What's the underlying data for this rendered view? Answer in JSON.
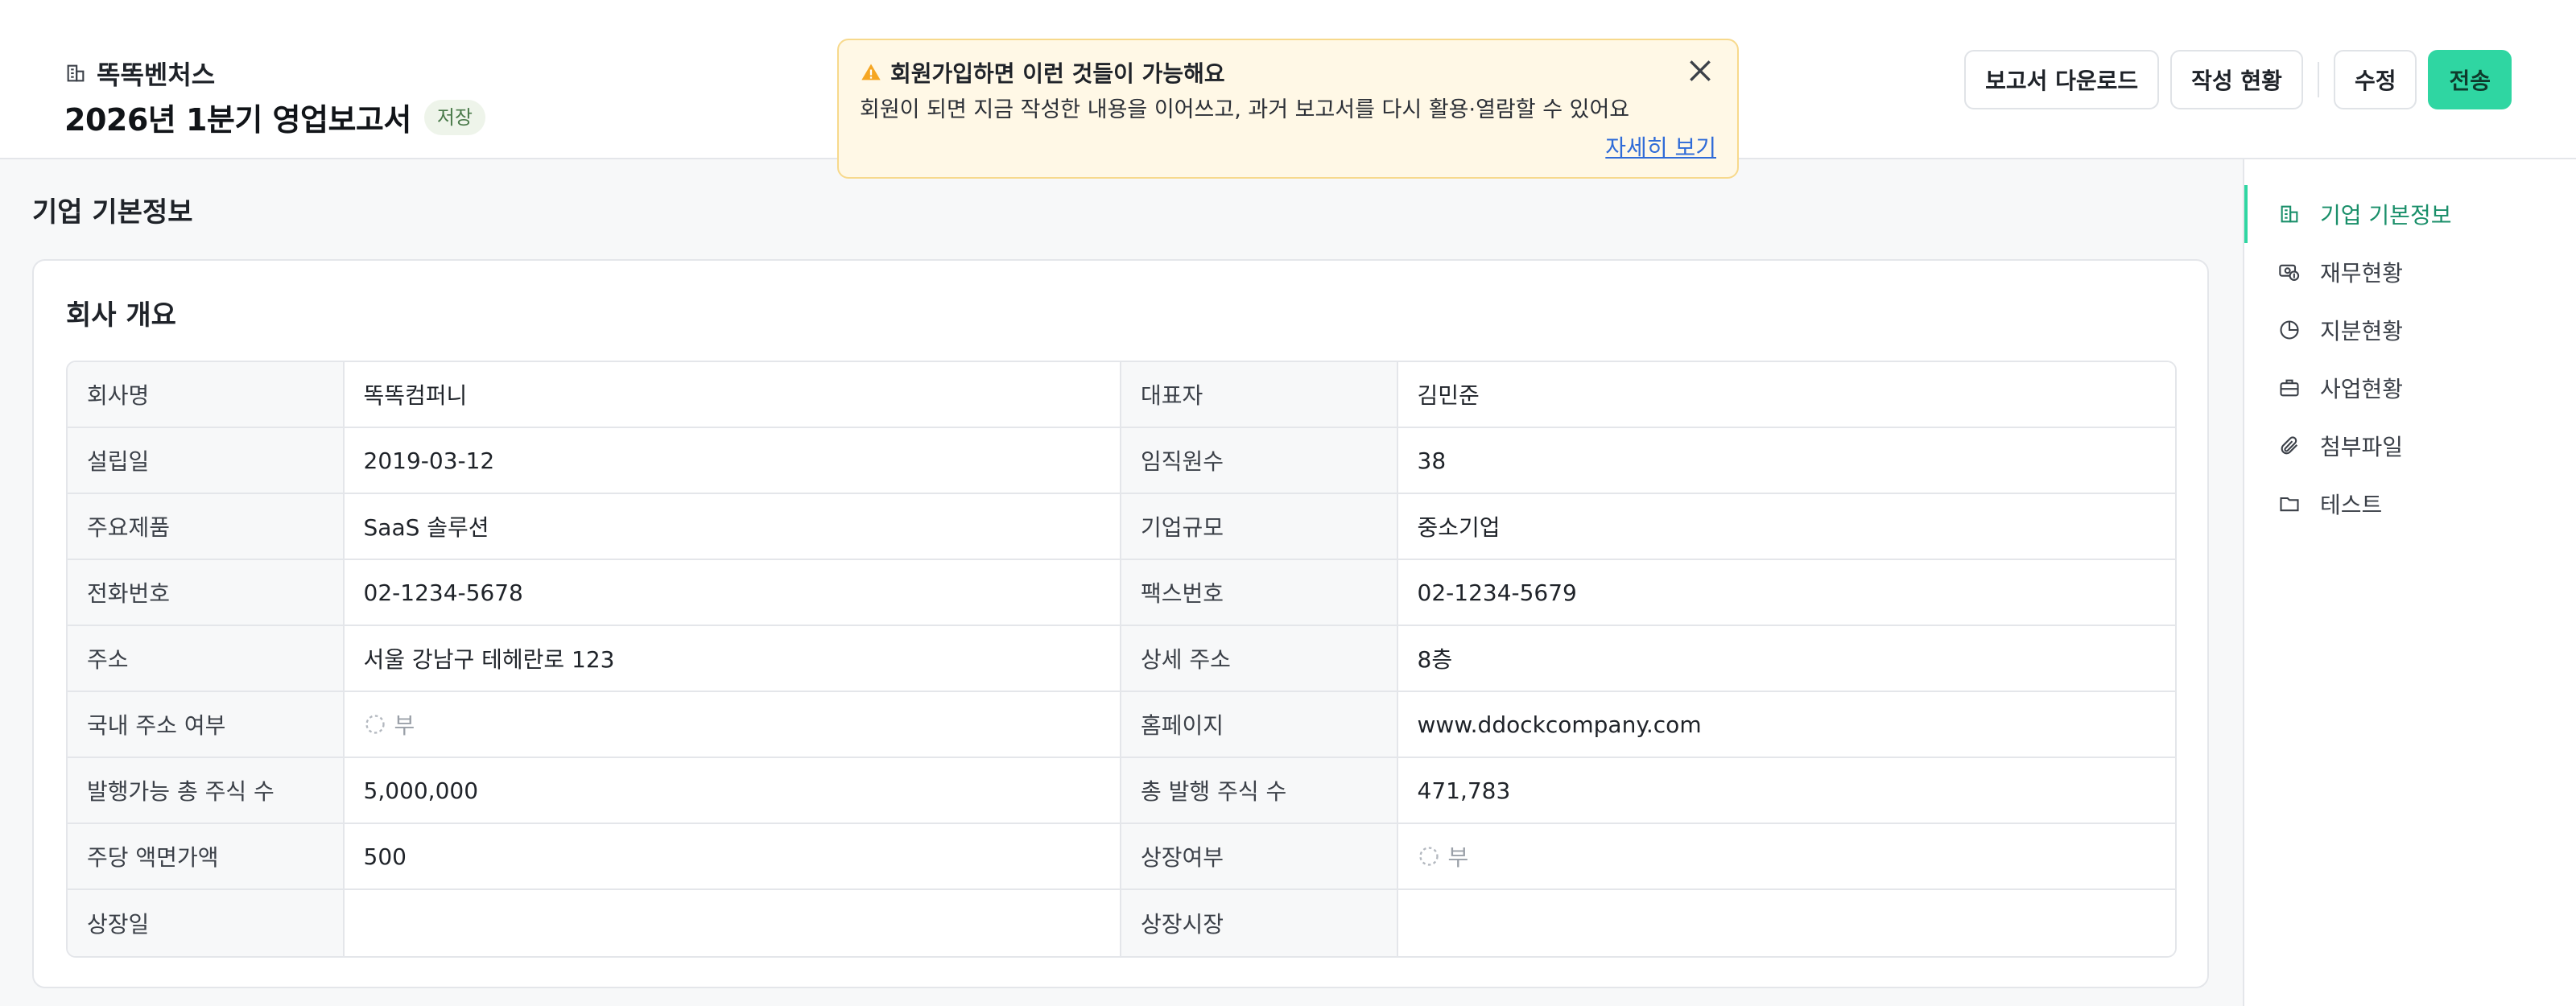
{
  "header": {
    "company": "똑똑벤처스",
    "title": "2026년 1분기 영업보고서",
    "badge": "저장"
  },
  "actions": {
    "download": "보고서 다운로드",
    "status": "작성 현황",
    "edit": "수정",
    "send": "전송"
  },
  "banner": {
    "title": "회원가입하면 이런 것들이 가능해요",
    "body": "회원이 되면 지금 작성한 내용을 이어쓰고, 과거 보고서를 다시 활용·열람할 수 있어요",
    "link": "자세히 보기"
  },
  "section": {
    "title": "기업 기본정보"
  },
  "card": {
    "title": "회사 개요"
  },
  "rows": [
    {
      "l1": "회사명",
      "v1": "똑똑컴퍼니",
      "l2": "대표자",
      "v2": "김민준"
    },
    {
      "l1": "설립일",
      "v1": "2019-03-12",
      "l2": "임직원수",
      "v2": "38"
    },
    {
      "l1": "주요제품",
      "v1": "SaaS 솔루션",
      "l2": "기업규모",
      "v2": "중소기업"
    },
    {
      "l1": "전화번호",
      "v1": "02-1234-5678",
      "l2": "팩스번호",
      "v2": "02-1234-5679"
    },
    {
      "l1": "주소",
      "v1": "서울 강남구 테헤란로 123",
      "l2": "상세 주소",
      "v2": "8층"
    },
    {
      "l1": "국내 주소 여부",
      "v1": "부",
      "l2": "홈페이지",
      "v2": "www.ddockcompany.com"
    },
    {
      "l1": "발행가능 총 주식 수",
      "v1": "5,000,000",
      "l2": "총 발행 주식 수",
      "v2": "471,783"
    },
    {
      "l1": "주당 액면가액",
      "v1": "500",
      "l2": "상장여부",
      "v2": "부"
    },
    {
      "l1": "상장일",
      "v1": "",
      "l2": "상장시장",
      "v2": ""
    }
  ],
  "nav": [
    {
      "label": "기업 기본정보",
      "icon": "building-icon",
      "active": true
    },
    {
      "label": "재무현황",
      "icon": "money-icon",
      "active": false
    },
    {
      "label": "지분현황",
      "icon": "pie-chart-icon",
      "active": false
    },
    {
      "label": "사업현황",
      "icon": "briefcase-icon",
      "active": false
    },
    {
      "label": "첨부파일",
      "icon": "paperclip-icon",
      "active": false
    },
    {
      "label": "테스트",
      "icon": "folder-icon",
      "active": false
    }
  ],
  "colors": {
    "accent": "#2fd6a2",
    "banner_bg": "#fff8e6",
    "link": "#2f6bd8"
  }
}
